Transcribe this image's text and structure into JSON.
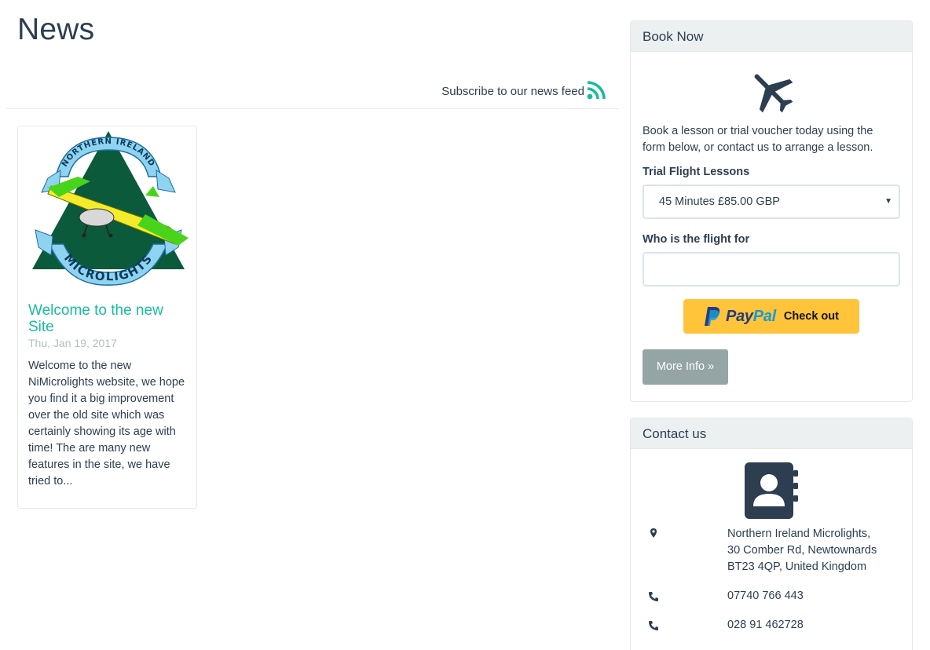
{
  "page": {
    "title": "News"
  },
  "feed": {
    "subscribe_label": "Subscribe to our news feed",
    "icon": "rss-icon"
  },
  "news": {
    "items": [
      {
        "title": "Welcome to the new Site",
        "date": "Thu, Jan 19, 2017",
        "excerpt": "Welcome to the new NiMicrolights website, we hope you find it a big improvement over the old site which was certainly showing its age with time! The are many new features in the site, we have tried to...",
        "logo": {
          "top_text": "NORTHERN IRELAND",
          "bottom_text": "MICROLIGHTS"
        }
      }
    ]
  },
  "book_now": {
    "heading": "Book Now",
    "icon": "plane-icon",
    "intro": "Book a lesson or trial voucher today using the form below, or contact us to arrange a lesson.",
    "lesson_label": "Trial Flight Lessons",
    "lesson_selected": "45 Minutes £85.00 GBP",
    "recipient_label": "Who is the flight for",
    "recipient_value": "",
    "paypal": {
      "pay": "Pay",
      "pal": "Pal",
      "checkout": "Check out"
    },
    "more_info_label": "More Info »"
  },
  "contact": {
    "heading": "Contact us",
    "icon": "address-book-icon",
    "address_lines": [
      "Northern Ireland Microlights,",
      "30 Comber Rd, Newtownards",
      "BT23 4QP, United Kingdom"
    ],
    "phone_1": "07740 766 443",
    "phone_2": "028 91 462728"
  },
  "colors": {
    "text": "#2c3e50",
    "link": "#18bc9c",
    "muted": "#b4bcc2",
    "panel_header": "#ecf0f1",
    "button_grey": "#95a5a6",
    "paypal_yellow": "#ffc439"
  }
}
